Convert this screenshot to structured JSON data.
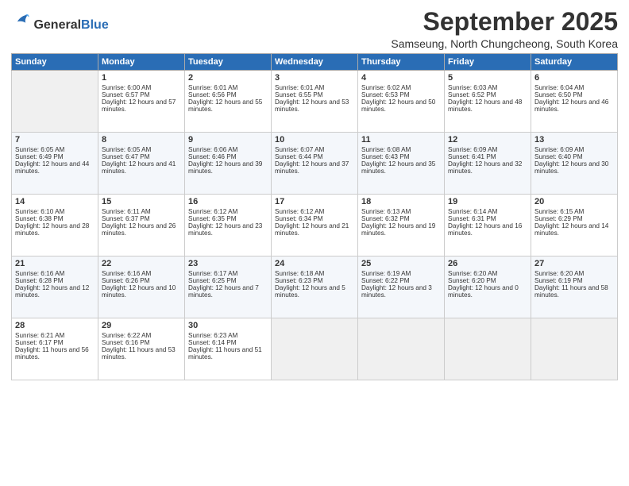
{
  "logo": {
    "general": "General",
    "blue": "Blue"
  },
  "header": {
    "title": "September 2025",
    "subtitle": "Samseung, North Chungcheong, South Korea"
  },
  "weekdays": [
    "Sunday",
    "Monday",
    "Tuesday",
    "Wednesday",
    "Thursday",
    "Friday",
    "Saturday"
  ],
  "weeks": [
    [
      {
        "day": "",
        "empty": true
      },
      {
        "day": "1",
        "sunrise": "Sunrise: 6:00 AM",
        "sunset": "Sunset: 6:57 PM",
        "daylight": "Daylight: 12 hours and 57 minutes."
      },
      {
        "day": "2",
        "sunrise": "Sunrise: 6:01 AM",
        "sunset": "Sunset: 6:56 PM",
        "daylight": "Daylight: 12 hours and 55 minutes."
      },
      {
        "day": "3",
        "sunrise": "Sunrise: 6:01 AM",
        "sunset": "Sunset: 6:55 PM",
        "daylight": "Daylight: 12 hours and 53 minutes."
      },
      {
        "day": "4",
        "sunrise": "Sunrise: 6:02 AM",
        "sunset": "Sunset: 6:53 PM",
        "daylight": "Daylight: 12 hours and 50 minutes."
      },
      {
        "day": "5",
        "sunrise": "Sunrise: 6:03 AM",
        "sunset": "Sunset: 6:52 PM",
        "daylight": "Daylight: 12 hours and 48 minutes."
      },
      {
        "day": "6",
        "sunrise": "Sunrise: 6:04 AM",
        "sunset": "Sunset: 6:50 PM",
        "daylight": "Daylight: 12 hours and 46 minutes."
      }
    ],
    [
      {
        "day": "7",
        "sunrise": "Sunrise: 6:05 AM",
        "sunset": "Sunset: 6:49 PM",
        "daylight": "Daylight: 12 hours and 44 minutes."
      },
      {
        "day": "8",
        "sunrise": "Sunrise: 6:05 AM",
        "sunset": "Sunset: 6:47 PM",
        "daylight": "Daylight: 12 hours and 41 minutes."
      },
      {
        "day": "9",
        "sunrise": "Sunrise: 6:06 AM",
        "sunset": "Sunset: 6:46 PM",
        "daylight": "Daylight: 12 hours and 39 minutes."
      },
      {
        "day": "10",
        "sunrise": "Sunrise: 6:07 AM",
        "sunset": "Sunset: 6:44 PM",
        "daylight": "Daylight: 12 hours and 37 minutes."
      },
      {
        "day": "11",
        "sunrise": "Sunrise: 6:08 AM",
        "sunset": "Sunset: 6:43 PM",
        "daylight": "Daylight: 12 hours and 35 minutes."
      },
      {
        "day": "12",
        "sunrise": "Sunrise: 6:09 AM",
        "sunset": "Sunset: 6:41 PM",
        "daylight": "Daylight: 12 hours and 32 minutes."
      },
      {
        "day": "13",
        "sunrise": "Sunrise: 6:09 AM",
        "sunset": "Sunset: 6:40 PM",
        "daylight": "Daylight: 12 hours and 30 minutes."
      }
    ],
    [
      {
        "day": "14",
        "sunrise": "Sunrise: 6:10 AM",
        "sunset": "Sunset: 6:38 PM",
        "daylight": "Daylight: 12 hours and 28 minutes."
      },
      {
        "day": "15",
        "sunrise": "Sunrise: 6:11 AM",
        "sunset": "Sunset: 6:37 PM",
        "daylight": "Daylight: 12 hours and 26 minutes."
      },
      {
        "day": "16",
        "sunrise": "Sunrise: 6:12 AM",
        "sunset": "Sunset: 6:35 PM",
        "daylight": "Daylight: 12 hours and 23 minutes."
      },
      {
        "day": "17",
        "sunrise": "Sunrise: 6:12 AM",
        "sunset": "Sunset: 6:34 PM",
        "daylight": "Daylight: 12 hours and 21 minutes."
      },
      {
        "day": "18",
        "sunrise": "Sunrise: 6:13 AM",
        "sunset": "Sunset: 6:32 PM",
        "daylight": "Daylight: 12 hours and 19 minutes."
      },
      {
        "day": "19",
        "sunrise": "Sunrise: 6:14 AM",
        "sunset": "Sunset: 6:31 PM",
        "daylight": "Daylight: 12 hours and 16 minutes."
      },
      {
        "day": "20",
        "sunrise": "Sunrise: 6:15 AM",
        "sunset": "Sunset: 6:29 PM",
        "daylight": "Daylight: 12 hours and 14 minutes."
      }
    ],
    [
      {
        "day": "21",
        "sunrise": "Sunrise: 6:16 AM",
        "sunset": "Sunset: 6:28 PM",
        "daylight": "Daylight: 12 hours and 12 minutes."
      },
      {
        "day": "22",
        "sunrise": "Sunrise: 6:16 AM",
        "sunset": "Sunset: 6:26 PM",
        "daylight": "Daylight: 12 hours and 10 minutes."
      },
      {
        "day": "23",
        "sunrise": "Sunrise: 6:17 AM",
        "sunset": "Sunset: 6:25 PM",
        "daylight": "Daylight: 12 hours and 7 minutes."
      },
      {
        "day": "24",
        "sunrise": "Sunrise: 6:18 AM",
        "sunset": "Sunset: 6:23 PM",
        "daylight": "Daylight: 12 hours and 5 minutes."
      },
      {
        "day": "25",
        "sunrise": "Sunrise: 6:19 AM",
        "sunset": "Sunset: 6:22 PM",
        "daylight": "Daylight: 12 hours and 3 minutes."
      },
      {
        "day": "26",
        "sunrise": "Sunrise: 6:20 AM",
        "sunset": "Sunset: 6:20 PM",
        "daylight": "Daylight: 12 hours and 0 minutes."
      },
      {
        "day": "27",
        "sunrise": "Sunrise: 6:20 AM",
        "sunset": "Sunset: 6:19 PM",
        "daylight": "Daylight: 11 hours and 58 minutes."
      }
    ],
    [
      {
        "day": "28",
        "sunrise": "Sunrise: 6:21 AM",
        "sunset": "Sunset: 6:17 PM",
        "daylight": "Daylight: 11 hours and 56 minutes."
      },
      {
        "day": "29",
        "sunrise": "Sunrise: 6:22 AM",
        "sunset": "Sunset: 6:16 PM",
        "daylight": "Daylight: 11 hours and 53 minutes."
      },
      {
        "day": "30",
        "sunrise": "Sunrise: 6:23 AM",
        "sunset": "Sunset: 6:14 PM",
        "daylight": "Daylight: 11 hours and 51 minutes."
      },
      {
        "day": "",
        "empty": true
      },
      {
        "day": "",
        "empty": true
      },
      {
        "day": "",
        "empty": true
      },
      {
        "day": "",
        "empty": true
      }
    ]
  ]
}
